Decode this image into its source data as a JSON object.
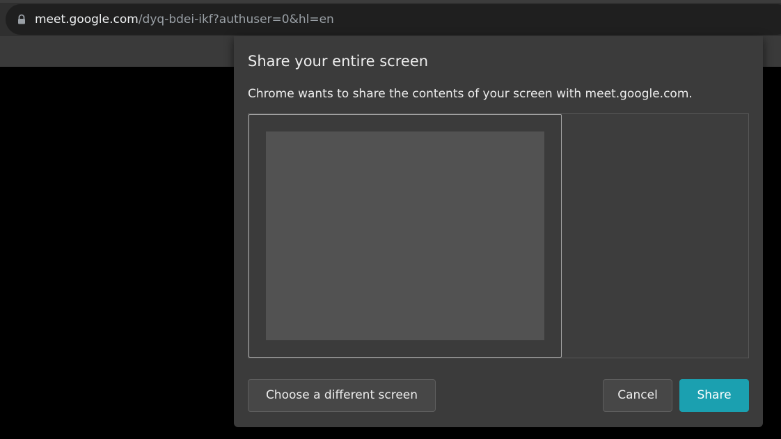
{
  "browser": {
    "address_bar": {
      "host": "meet.google.com",
      "path": "/dyq-bdei-ikf?authuser=0&hl=en",
      "security_icon": "lock-icon"
    }
  },
  "share_dialog": {
    "title": "Share your entire screen",
    "message": "Chrome wants to share the contents of your screen with meet.google.com.",
    "buttons": {
      "choose_different_label": "Choose a different screen",
      "cancel_label": "Cancel",
      "share_label": "Share"
    },
    "accent_color": "#1ba0b0"
  }
}
